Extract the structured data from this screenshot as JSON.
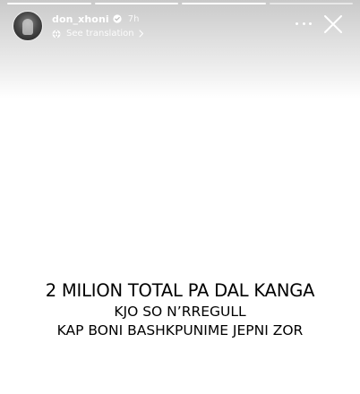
{
  "header": {
    "username": "don_xhoni",
    "time": "7h",
    "translation_label": "See translation",
    "progress": [
      1,
      1,
      1,
      0
    ]
  },
  "icons": {
    "avatar": "profile-avatar",
    "verified": "verified-badge-icon",
    "translate": "translate-globe-icon",
    "chevron": "chevron-right-icon",
    "more": "more-horizontal-icon",
    "close": "close-icon"
  },
  "caption": {
    "line1": "2 MILION TOTAL PA DAL KANGA",
    "line2": "KJO SO N’RREGULL",
    "line3": "KAP BONI BASHKPUNIME JEPNI ZOR"
  },
  "colors": {
    "background": "#ffffff",
    "caption_text": "#000000",
    "overlay_text": "#ffffff"
  }
}
